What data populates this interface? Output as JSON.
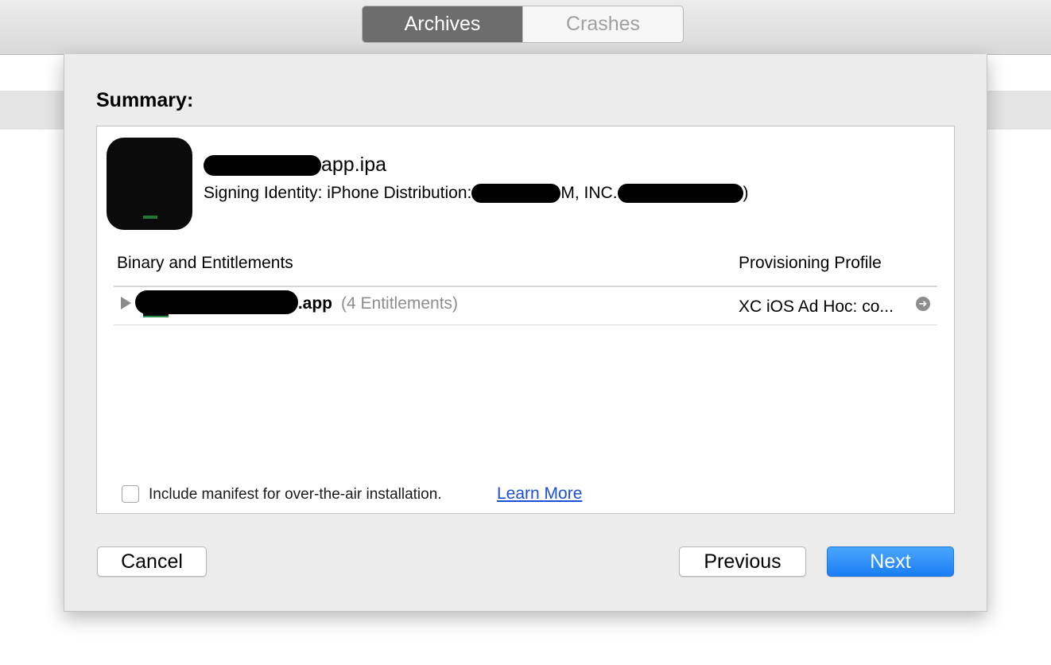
{
  "toolbar": {
    "tabs": [
      {
        "label": "Archives",
        "active": true
      },
      {
        "label": "Crashes",
        "active": false
      }
    ]
  },
  "summary": {
    "title": "Summary:",
    "ipa_name_visible": "app.ipa",
    "signing_prefix": "Signing Identity: iPhone Distribution:",
    "signing_mid": "M, INC.",
    "signing_suffix": ")"
  },
  "table": {
    "headers": {
      "binary": "Binary and Entitlements",
      "profile": "Provisioning Profile"
    },
    "rows": [
      {
        "app_name_visible": "p.app",
        "entitlements": "(4 Entitlements)",
        "profile": "XC iOS Ad Hoc: co..."
      }
    ]
  },
  "manifest": {
    "checked": false,
    "label": "Include manifest for over-the-air installation.",
    "link": "Learn More"
  },
  "buttons": {
    "cancel": "Cancel",
    "previous": "Previous",
    "next": "Next"
  },
  "colors": {
    "accent": "#1a7ef5",
    "link": "#1a4fd8",
    "active_tab": "#6d6d6d"
  },
  "icons": {
    "app": "app-icon",
    "disclosure": "disclosure-triangle-icon",
    "profile_details": "arrow-circle-right-icon"
  }
}
